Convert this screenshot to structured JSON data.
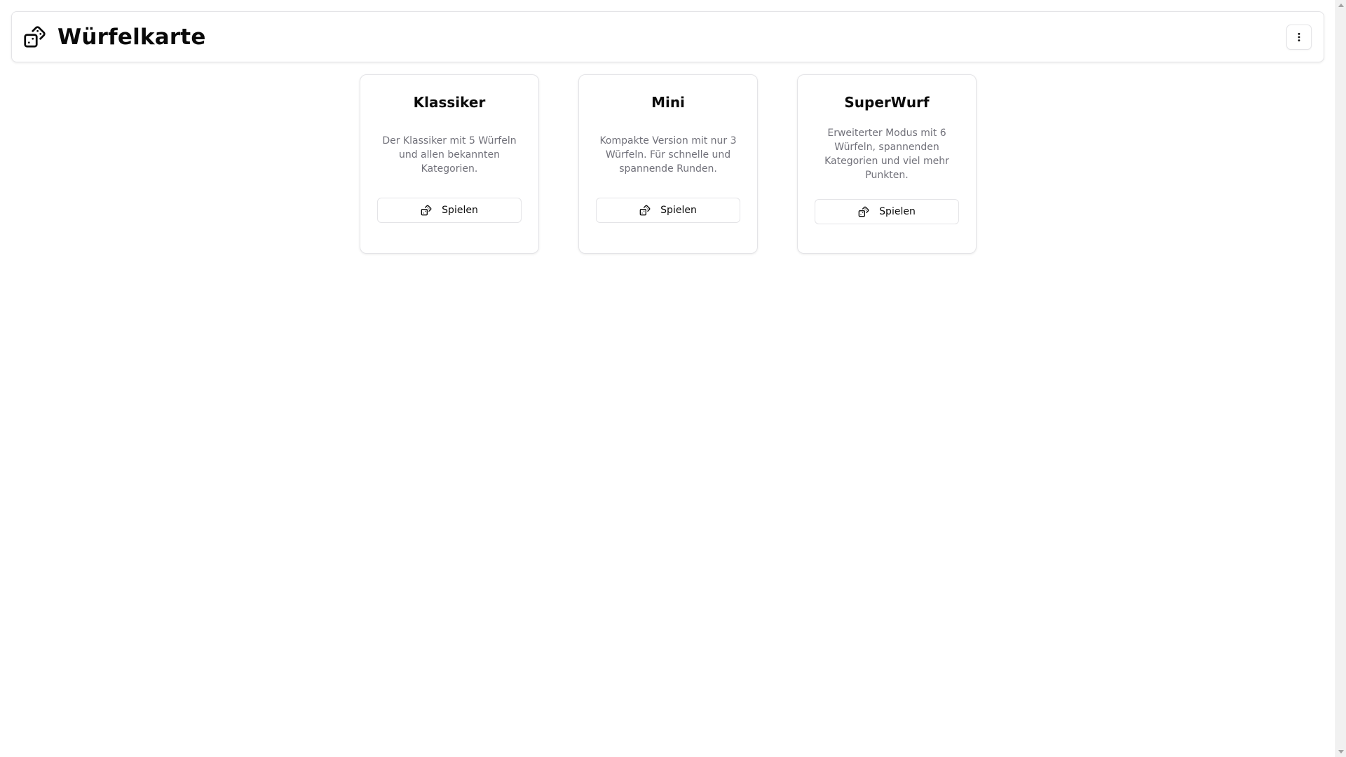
{
  "header": {
    "title": "Würfelkarte",
    "logo_icon": "dices-icon",
    "menu_icon": "ellipsis-vertical-icon"
  },
  "games": [
    {
      "title": "Klassiker",
      "description": "Der Klassiker mit 5 Würfeln und allen bekannten Kategorien.",
      "button_label": "Spielen",
      "button_icon": "dices-icon"
    },
    {
      "title": "Mini",
      "description": "Kompakte Version mit nur 3 Würfeln. Für schnelle und spannende Runden.",
      "button_label": "Spielen",
      "button_icon": "dices-icon"
    },
    {
      "title": "SuperWurf",
      "description": "Erweiterter Modus mit 6 Würfeln, spannenden Kategorien und viel mehr Punkten.",
      "button_label": "Spielen",
      "button_icon": "dices-icon"
    }
  ],
  "colors": {
    "text": "#0a0a0a",
    "muted_text": "#71717a",
    "border": "#e4e4e7",
    "background": "#ffffff"
  }
}
